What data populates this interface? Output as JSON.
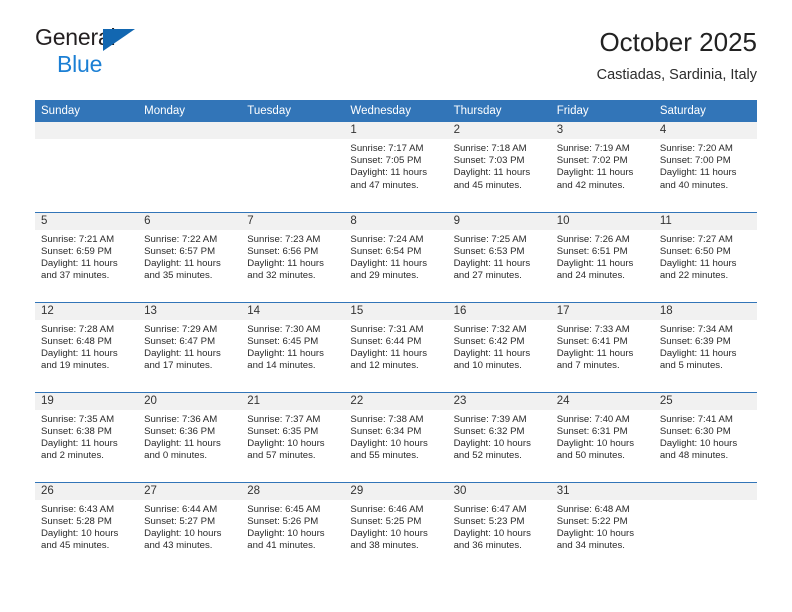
{
  "logo": {
    "word_dark": "General",
    "word_blue": "Blue",
    "triangle_color": "#1267b1",
    "blue_color": "#1b7fd4"
  },
  "header": {
    "title": "October 2025",
    "subtitle": "Castiadas, Sardinia, Italy"
  },
  "theme": {
    "header_blue": "#3275b8",
    "daynum_band": "#f1f1f1",
    "text": "#2a2a2a"
  },
  "weekday_headers": [
    "Sunday",
    "Monday",
    "Tuesday",
    "Wednesday",
    "Thursday",
    "Friday",
    "Saturday"
  ],
  "weeks": [
    [
      {
        "day": "",
        "sunrise": "",
        "sunset": "",
        "daylight": ""
      },
      {
        "day": "",
        "sunrise": "",
        "sunset": "",
        "daylight": ""
      },
      {
        "day": "",
        "sunrise": "",
        "sunset": "",
        "daylight": ""
      },
      {
        "day": "1",
        "sunrise": "Sunrise: 7:17 AM",
        "sunset": "Sunset: 7:05 PM",
        "daylight": "Daylight: 11 hours and 47 minutes."
      },
      {
        "day": "2",
        "sunrise": "Sunrise: 7:18 AM",
        "sunset": "Sunset: 7:03 PM",
        "daylight": "Daylight: 11 hours and 45 minutes."
      },
      {
        "day": "3",
        "sunrise": "Sunrise: 7:19 AM",
        "sunset": "Sunset: 7:02 PM",
        "daylight": "Daylight: 11 hours and 42 minutes."
      },
      {
        "day": "4",
        "sunrise": "Sunrise: 7:20 AM",
        "sunset": "Sunset: 7:00 PM",
        "daylight": "Daylight: 11 hours and 40 minutes."
      }
    ],
    [
      {
        "day": "5",
        "sunrise": "Sunrise: 7:21 AM",
        "sunset": "Sunset: 6:59 PM",
        "daylight": "Daylight: 11 hours and 37 minutes."
      },
      {
        "day": "6",
        "sunrise": "Sunrise: 7:22 AM",
        "sunset": "Sunset: 6:57 PM",
        "daylight": "Daylight: 11 hours and 35 minutes."
      },
      {
        "day": "7",
        "sunrise": "Sunrise: 7:23 AM",
        "sunset": "Sunset: 6:56 PM",
        "daylight": "Daylight: 11 hours and 32 minutes."
      },
      {
        "day": "8",
        "sunrise": "Sunrise: 7:24 AM",
        "sunset": "Sunset: 6:54 PM",
        "daylight": "Daylight: 11 hours and 29 minutes."
      },
      {
        "day": "9",
        "sunrise": "Sunrise: 7:25 AM",
        "sunset": "Sunset: 6:53 PM",
        "daylight": "Daylight: 11 hours and 27 minutes."
      },
      {
        "day": "10",
        "sunrise": "Sunrise: 7:26 AM",
        "sunset": "Sunset: 6:51 PM",
        "daylight": "Daylight: 11 hours and 24 minutes."
      },
      {
        "day": "11",
        "sunrise": "Sunrise: 7:27 AM",
        "sunset": "Sunset: 6:50 PM",
        "daylight": "Daylight: 11 hours and 22 minutes."
      }
    ],
    [
      {
        "day": "12",
        "sunrise": "Sunrise: 7:28 AM",
        "sunset": "Sunset: 6:48 PM",
        "daylight": "Daylight: 11 hours and 19 minutes."
      },
      {
        "day": "13",
        "sunrise": "Sunrise: 7:29 AM",
        "sunset": "Sunset: 6:47 PM",
        "daylight": "Daylight: 11 hours and 17 minutes."
      },
      {
        "day": "14",
        "sunrise": "Sunrise: 7:30 AM",
        "sunset": "Sunset: 6:45 PM",
        "daylight": "Daylight: 11 hours and 14 minutes."
      },
      {
        "day": "15",
        "sunrise": "Sunrise: 7:31 AM",
        "sunset": "Sunset: 6:44 PM",
        "daylight": "Daylight: 11 hours and 12 minutes."
      },
      {
        "day": "16",
        "sunrise": "Sunrise: 7:32 AM",
        "sunset": "Sunset: 6:42 PM",
        "daylight": "Daylight: 11 hours and 10 minutes."
      },
      {
        "day": "17",
        "sunrise": "Sunrise: 7:33 AM",
        "sunset": "Sunset: 6:41 PM",
        "daylight": "Daylight: 11 hours and 7 minutes."
      },
      {
        "day": "18",
        "sunrise": "Sunrise: 7:34 AM",
        "sunset": "Sunset: 6:39 PM",
        "daylight": "Daylight: 11 hours and 5 minutes."
      }
    ],
    [
      {
        "day": "19",
        "sunrise": "Sunrise: 7:35 AM",
        "sunset": "Sunset: 6:38 PM",
        "daylight": "Daylight: 11 hours and 2 minutes."
      },
      {
        "day": "20",
        "sunrise": "Sunrise: 7:36 AM",
        "sunset": "Sunset: 6:36 PM",
        "daylight": "Daylight: 11 hours and 0 minutes."
      },
      {
        "day": "21",
        "sunrise": "Sunrise: 7:37 AM",
        "sunset": "Sunset: 6:35 PM",
        "daylight": "Daylight: 10 hours and 57 minutes."
      },
      {
        "day": "22",
        "sunrise": "Sunrise: 7:38 AM",
        "sunset": "Sunset: 6:34 PM",
        "daylight": "Daylight: 10 hours and 55 minutes."
      },
      {
        "day": "23",
        "sunrise": "Sunrise: 7:39 AM",
        "sunset": "Sunset: 6:32 PM",
        "daylight": "Daylight: 10 hours and 52 minutes."
      },
      {
        "day": "24",
        "sunrise": "Sunrise: 7:40 AM",
        "sunset": "Sunset: 6:31 PM",
        "daylight": "Daylight: 10 hours and 50 minutes."
      },
      {
        "day": "25",
        "sunrise": "Sunrise: 7:41 AM",
        "sunset": "Sunset: 6:30 PM",
        "daylight": "Daylight: 10 hours and 48 minutes."
      }
    ],
    [
      {
        "day": "26",
        "sunrise": "Sunrise: 6:43 AM",
        "sunset": "Sunset: 5:28 PM",
        "daylight": "Daylight: 10 hours and 45 minutes."
      },
      {
        "day": "27",
        "sunrise": "Sunrise: 6:44 AM",
        "sunset": "Sunset: 5:27 PM",
        "daylight": "Daylight: 10 hours and 43 minutes."
      },
      {
        "day": "28",
        "sunrise": "Sunrise: 6:45 AM",
        "sunset": "Sunset: 5:26 PM",
        "daylight": "Daylight: 10 hours and 41 minutes."
      },
      {
        "day": "29",
        "sunrise": "Sunrise: 6:46 AM",
        "sunset": "Sunset: 5:25 PM",
        "daylight": "Daylight: 10 hours and 38 minutes."
      },
      {
        "day": "30",
        "sunrise": "Sunrise: 6:47 AM",
        "sunset": "Sunset: 5:23 PM",
        "daylight": "Daylight: 10 hours and 36 minutes."
      },
      {
        "day": "31",
        "sunrise": "Sunrise: 6:48 AM",
        "sunset": "Sunset: 5:22 PM",
        "daylight": "Daylight: 10 hours and 34 minutes."
      },
      {
        "day": "",
        "sunrise": "",
        "sunset": "",
        "daylight": ""
      }
    ]
  ]
}
